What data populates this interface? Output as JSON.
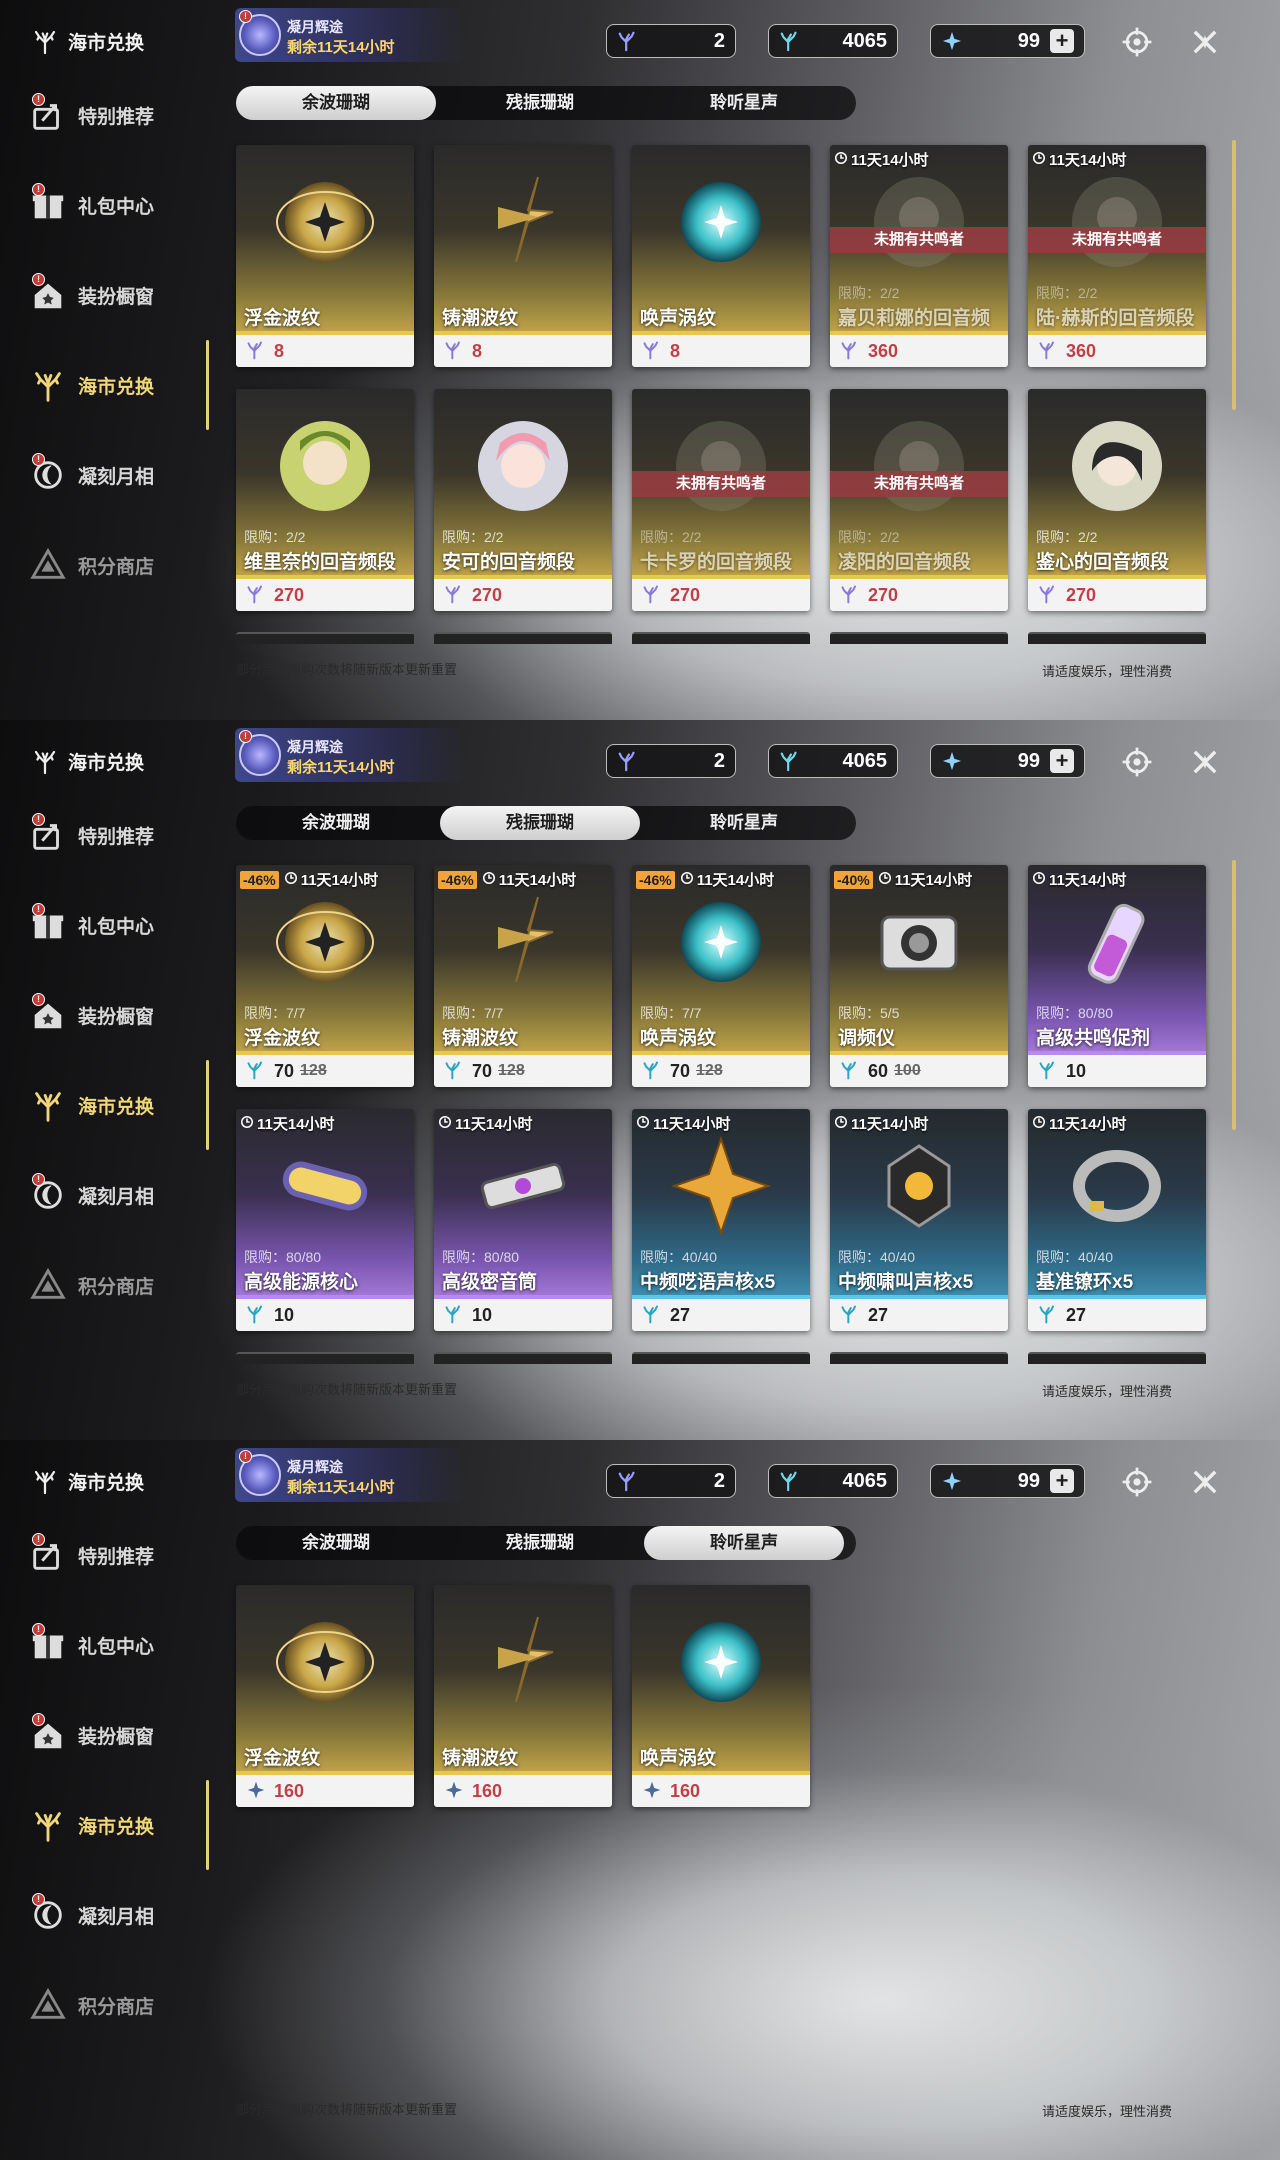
{
  "sidebar": {
    "title": "海市兑换",
    "items": [
      {
        "label": "特别推荐",
        "icon": "gift-arrow-icon",
        "badge": "!",
        "active": false
      },
      {
        "label": "礼包中心",
        "icon": "gift-box-icon",
        "badge": "!",
        "active": false
      },
      {
        "label": "装扮橱窗",
        "icon": "house-star-icon",
        "badge": "!",
        "active": false
      },
      {
        "label": "海市兑换",
        "icon": "coral-icon",
        "badge": "",
        "active": true
      },
      {
        "label": "凝刻月相",
        "icon": "moon-icon",
        "badge": "!",
        "active": false
      },
      {
        "label": "积分商店",
        "icon": "triangle-icon",
        "badge": "",
        "active": false
      }
    ]
  },
  "event": {
    "title": "凝月辉途",
    "remaining": "剩余11天14小时",
    "badge": "!"
  },
  "currencies": [
    {
      "name": "余波珊瑚",
      "value": "2",
      "icon": "coral-currency-icon",
      "color": "#9a9cff"
    },
    {
      "name": "残振珊瑚",
      "value": "4065",
      "icon": "coral-currency-icon",
      "color": "#6fd7e8"
    },
    {
      "name": "星声",
      "value": "99",
      "icon": "star-currency-icon",
      "color": "#8fd0ff",
      "plus": "+"
    }
  ],
  "tabs": [
    "余波珊瑚",
    "残振珊瑚",
    "聆听星声"
  ],
  "footer": {
    "left": "部分商品限购次数将随新版本更新重置",
    "right": "请适度娱乐，理性消费"
  },
  "panels": [
    {
      "selected_tab": 1,
      "cards": [
        {
          "name": "浮金波纹",
          "price": "8",
          "theme": "gold",
          "art": "gold-orb",
          "limit": "",
          "timer": "",
          "discount": "",
          "old": "",
          "not_owned": ""
        },
        {
          "name": "铸潮波纹",
          "price": "8",
          "theme": "gold",
          "art": "gold-blade",
          "limit": "",
          "timer": "",
          "discount": "",
          "old": "",
          "not_owned": ""
        },
        {
          "name": "唤声涡纹",
          "price": "8",
          "theme": "gold",
          "art": "teal-orb",
          "limit": "",
          "timer": "",
          "discount": "",
          "old": "",
          "not_owned": ""
        },
        {
          "name": "嘉贝莉娜的回音频段",
          "price": "360",
          "theme": "gold",
          "art": "portrait",
          "limit": "限购：2/2",
          "timer": "11天14小时",
          "discount": "",
          "old": "",
          "not_owned": "未拥有共鸣者",
          "dimmed": true
        },
        {
          "name": "陆·赫斯的回音频段",
          "price": "360",
          "theme": "gold",
          "art": "portrait",
          "limit": "限购：2/2",
          "timer": "11天14小时",
          "discount": "",
          "old": "",
          "not_owned": "未拥有共鸣者",
          "dimmed": true
        },
        {
          "name": "维里奈的回音频段",
          "price": "270",
          "theme": "gold",
          "art": "portrait-green",
          "limit": "限购：2/2",
          "timer": "",
          "discount": "",
          "old": "",
          "not_owned": ""
        },
        {
          "name": "安可的回音频段",
          "price": "270",
          "theme": "gold",
          "art": "portrait-pink",
          "limit": "限购：2/2",
          "timer": "",
          "discount": "",
          "old": "",
          "not_owned": ""
        },
        {
          "name": "卡卡罗的回音频段",
          "price": "270",
          "theme": "gold",
          "art": "portrait",
          "limit": "限购：2/2",
          "timer": "",
          "discount": "",
          "old": "",
          "not_owned": "未拥有共鸣者",
          "dimmed": true
        },
        {
          "name": "凌阳的回音频段",
          "price": "270",
          "theme": "gold",
          "art": "portrait",
          "limit": "限购：2/2",
          "timer": "",
          "discount": "",
          "old": "",
          "not_owned": "未拥有共鸣者",
          "dimmed": true
        },
        {
          "name": "鉴心的回音频段",
          "price": "270",
          "theme": "gold",
          "art": "portrait-dark",
          "limit": "限购：2/2",
          "timer": "",
          "discount": "",
          "old": "",
          "not_owned": ""
        }
      ]
    },
    {
      "selected_tab": 2,
      "cards": [
        {
          "name": "浮金波纹",
          "price": "70",
          "theme": "gold",
          "art": "gold-orb",
          "limit": "限购：7/7",
          "timer": "11天14小时",
          "discount": "-46%",
          "old": "128",
          "not_owned": ""
        },
        {
          "name": "铸潮波纹",
          "price": "70",
          "theme": "gold",
          "art": "gold-blade",
          "limit": "限购：7/7",
          "timer": "11天14小时",
          "discount": "-46%",
          "old": "128",
          "not_owned": ""
        },
        {
          "name": "唤声涡纹",
          "price": "70",
          "theme": "gold",
          "art": "teal-orb",
          "limit": "限购：7/7",
          "timer": "11天14小时",
          "discount": "-46%",
          "old": "128",
          "not_owned": ""
        },
        {
          "name": "调频仪",
          "price": "60",
          "theme": "gold",
          "art": "device",
          "limit": "限购：5/5",
          "timer": "11天14小时",
          "discount": "-40%",
          "old": "100",
          "not_owned": ""
        },
        {
          "name": "高级共鸣促剂",
          "price": "10",
          "theme": "purple",
          "art": "vial",
          "limit": "限购：80/80",
          "timer": "11天14小时",
          "discount": "",
          "old": "",
          "not_owned": ""
        },
        {
          "name": "高级能源核心",
          "price": "10",
          "theme": "purple",
          "art": "capsule",
          "limit": "限购：80/80",
          "timer": "11天14小时",
          "discount": "",
          "old": "",
          "not_owned": ""
        },
        {
          "name": "高级密音筒",
          "price": "10",
          "theme": "purple",
          "art": "cylinder",
          "limit": "限购：80/80",
          "timer": "11天14小时",
          "discount": "",
          "old": "",
          "not_owned": ""
        },
        {
          "name": "中频呓语声核x5",
          "price": "27",
          "theme": "blue",
          "art": "star-core",
          "limit": "限购：40/40",
          "timer": "11天14小时",
          "discount": "",
          "old": "",
          "not_owned": ""
        },
        {
          "name": "中频啸叫声核x5",
          "price": "27",
          "theme": "blue",
          "art": "dark-core",
          "limit": "限购：40/40",
          "timer": "11天14小时",
          "discount": "",
          "old": "",
          "not_owned": ""
        },
        {
          "name": "基准镣环x5",
          "price": "27",
          "theme": "blue",
          "art": "ring",
          "limit": "限购：40/40",
          "timer": "11天14小时",
          "discount": "",
          "old": "",
          "not_owned": ""
        }
      ]
    },
    {
      "selected_tab": 3,
      "cards": [
        {
          "name": "浮金波纹",
          "price": "160",
          "theme": "gold",
          "art": "gold-orb",
          "limit": "",
          "timer": "",
          "discount": "",
          "old": "",
          "not_owned": ""
        },
        {
          "name": "铸潮波纹",
          "price": "160",
          "theme": "gold",
          "art": "gold-blade",
          "limit": "",
          "timer": "",
          "discount": "",
          "old": "",
          "not_owned": ""
        },
        {
          "name": "唤声涡纹",
          "price": "160",
          "theme": "gold",
          "art": "teal-orb",
          "limit": "",
          "timer": "",
          "discount": "",
          "old": "",
          "not_owned": ""
        }
      ]
    }
  ],
  "colors": {
    "accent": "#f1d67a",
    "price_red": "#c0404a",
    "discount": "#f2a43a",
    "not_owned": "#963c41"
  }
}
